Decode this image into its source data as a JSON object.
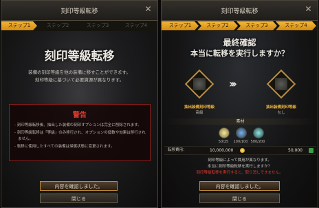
{
  "left": {
    "title": "刻印等級転移",
    "steps": [
      "ステップ1",
      "ステップ2",
      "ステップ3",
      "ステップ4"
    ],
    "heading": "刻印等級転移",
    "desc1": "装備の刻印等級を他の装備に移すことができます。",
    "desc2": "刻印等級に基づいて必要資源が異なります。",
    "warning_title": "警告",
    "warning_lines": [
      "- 刻印等級転移後、抽出した装備の刻印オプションは完全に削除されます。",
      "- 刻印等級転移は「等級」のみ移行され、オプションの個数や効果は移行され",
      "ません。",
      "- 転移に使用したすべての装備は帰属状態に変更されます。"
    ],
    "confirm_button": "内容を確認しました。",
    "close_button": "閉じる"
  },
  "right": {
    "title": "刻印等級転移",
    "steps": [
      "ステップ1",
      "ステップ2",
      "ステップ3",
      "ステップ4"
    ],
    "heading_line1": "最終確認",
    "heading_line2": "本当に転移を実行しますか？",
    "source_label": "抽出装備刻印等級",
    "source_grade": "高級",
    "target_label": "抽出装備刻印等級",
    "target_grade": "なし",
    "materials_title": "素材",
    "materials": [
      "50/25",
      "100/100",
      "500/200"
    ],
    "cost_label": "転移費用：",
    "cost_value": "10,000,000",
    "have_value": "50,000",
    "confirm_lines": [
      "刻印等級によって費用が異なります。",
      "本当に刻印等級転移を実行しますか？"
    ],
    "confirm_warning": "刻印等級転移を実行すると、取り消しできません。",
    "confirm_button": "内容を確認しました。",
    "close_button": "閉じる"
  },
  "colors": {
    "accent": "#e49a1c",
    "warning_red": "#e23a30",
    "gold_label": "#f0b43c",
    "text": "#c9c5bc"
  }
}
